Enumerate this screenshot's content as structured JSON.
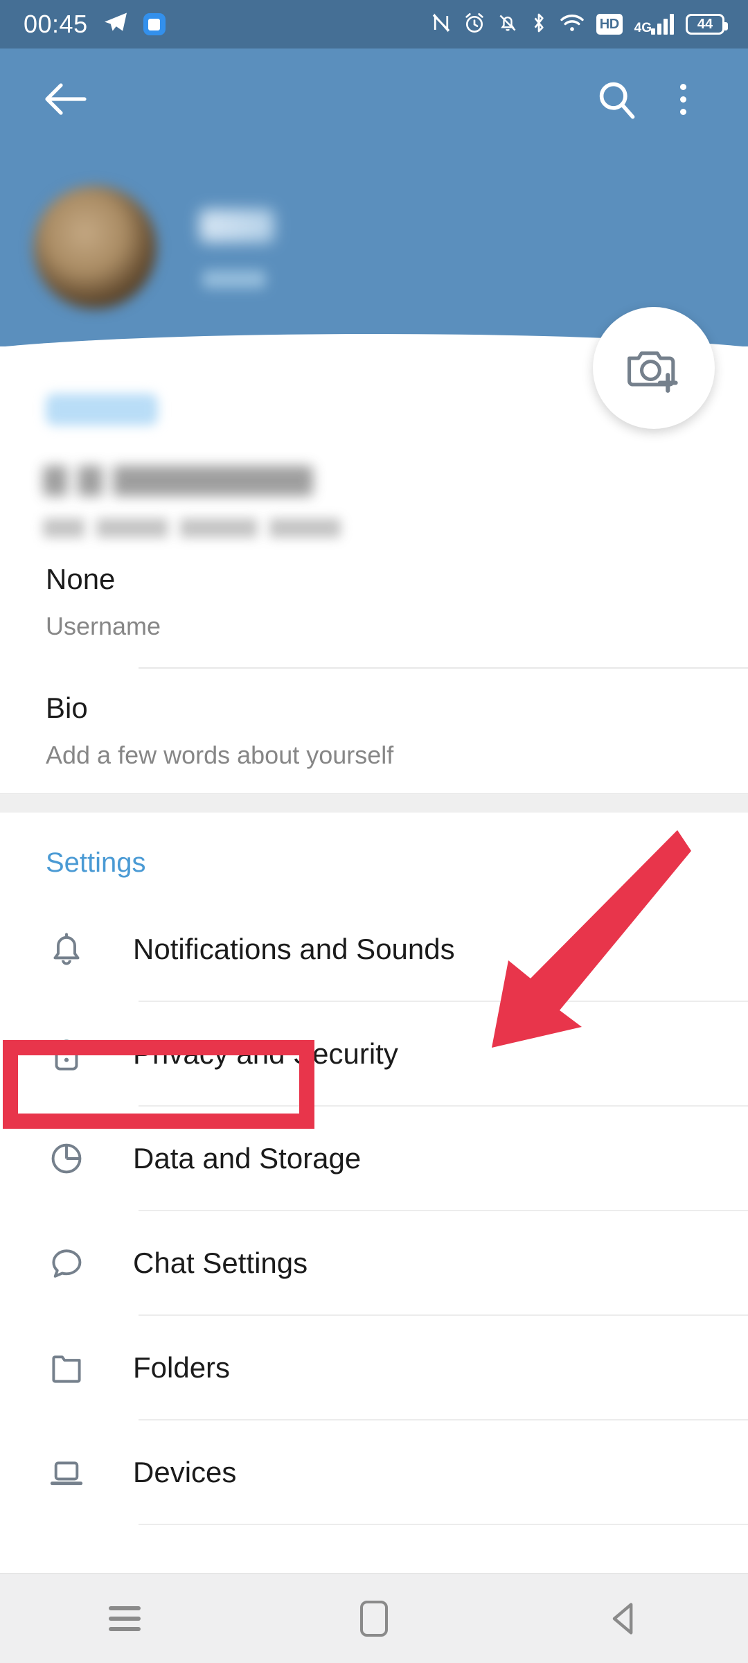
{
  "status_bar": {
    "time": "00:45",
    "left_icons": [
      "telegram-plane-icon",
      "app-icon"
    ],
    "right_icons": [
      "nfc-icon",
      "alarm-icon",
      "bell-muted-icon",
      "bluetooth-icon",
      "wifi-icon",
      "hd-icon",
      "signal-icon"
    ],
    "hd_label": "HD",
    "network_label": "4G",
    "battery_level": "44",
    "background_color": "#456f95"
  },
  "toolbar": {
    "back_label": "Back",
    "search_label": "Search",
    "menu_label": "More options",
    "background_color": "#5b8fbd"
  },
  "profile": {
    "name": "",
    "status": "",
    "avatar_label": "Profile photo",
    "change_photo_label": "Change profile photo"
  },
  "account_section": {
    "title": "",
    "phone": "",
    "subtitle": ""
  },
  "fields": [
    {
      "value": "None",
      "label": "Username"
    },
    {
      "value": "Bio",
      "label": "Add a few words about yourself"
    }
  ],
  "settings": {
    "header": "Settings",
    "header_color": "#4a9ad4",
    "items": [
      {
        "label": "Notifications and Sounds",
        "icon": "bell-icon"
      },
      {
        "label": "Privacy and Security",
        "icon": "lock-icon"
      },
      {
        "label": "Data and Storage",
        "icon": "pie-chart-icon"
      },
      {
        "label": "Chat Settings",
        "icon": "chat-bubble-icon"
      },
      {
        "label": "Folders",
        "icon": "folder-icon"
      },
      {
        "label": "Devices",
        "icon": "laptop-icon"
      }
    ]
  },
  "annotations": {
    "highlight_target": "Privacy and Security",
    "highlight_color": "#e8354b",
    "arrow_color": "#e8354b"
  },
  "nav_bar": {
    "recents_label": "Recent apps",
    "home_label": "Home",
    "back_label": "Back",
    "background_color": "#efeff0"
  }
}
